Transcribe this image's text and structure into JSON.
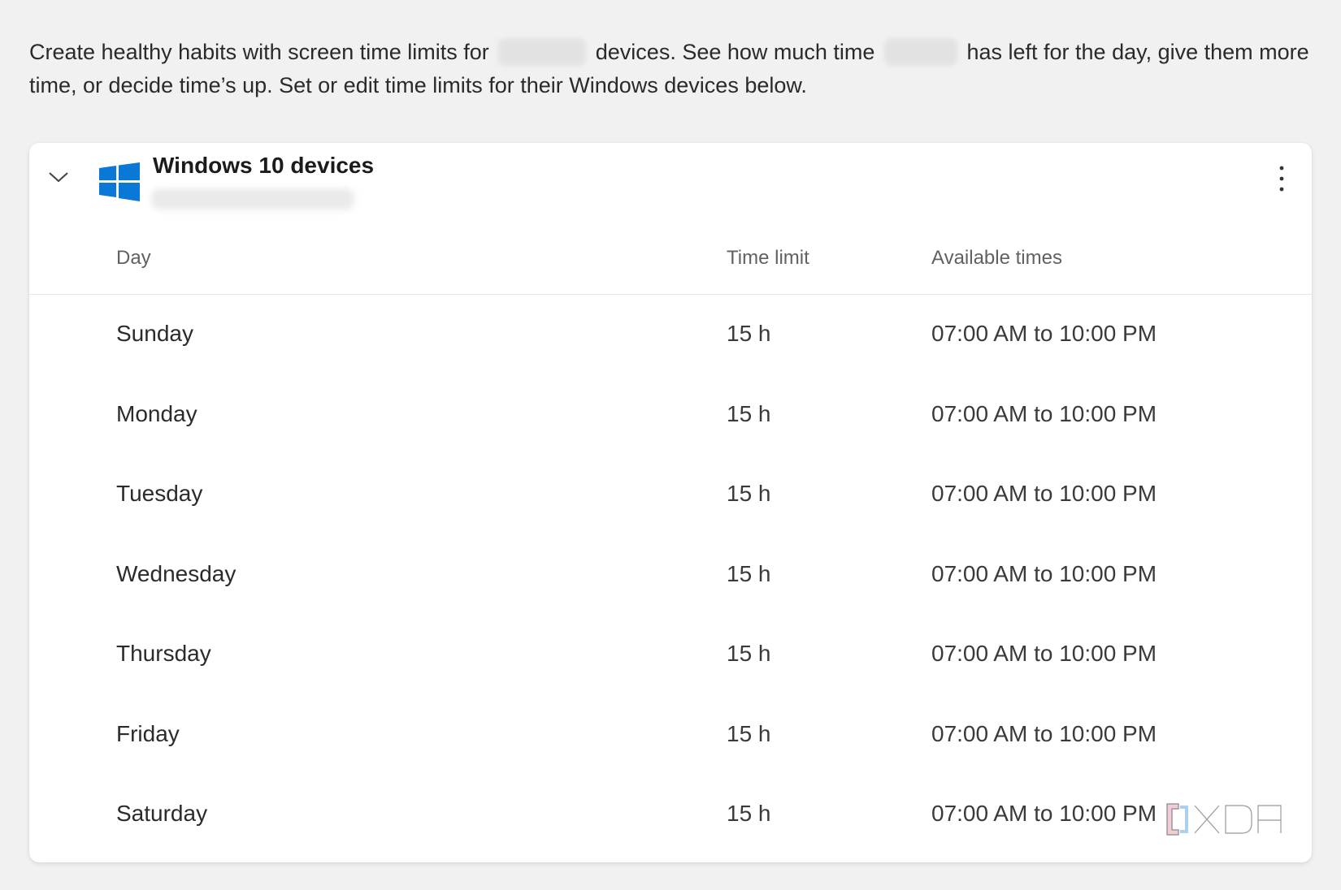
{
  "intro": {
    "part1": "Create healthy habits with screen time limits for",
    "part2": "devices. See how much time",
    "part3": "has left for the day, give them more time, or decide time’s up. Set or edit time limits for their Windows devices below."
  },
  "card": {
    "title": "Windows 10 devices",
    "logo_icon": "windows-logo-icon",
    "accent_color": "#0a78d7"
  },
  "table": {
    "headers": {
      "day": "Day",
      "time_limit": "Time limit",
      "available_times": "Available times"
    },
    "rows": [
      {
        "day": "Sunday",
        "limit": "15 h",
        "available": "07:00 AM to 10:00 PM"
      },
      {
        "day": "Monday",
        "limit": "15 h",
        "available": "07:00 AM to 10:00 PM"
      },
      {
        "day": "Tuesday",
        "limit": "15 h",
        "available": "07:00 AM to 10:00 PM"
      },
      {
        "day": "Wednesday",
        "limit": "15 h",
        "available": "07:00 AM to 10:00 PM"
      },
      {
        "day": "Thursday",
        "limit": "15 h",
        "available": "07:00 AM to 10:00 PM"
      },
      {
        "day": "Friday",
        "limit": "15 h",
        "available": "07:00 AM to 10:00 PM"
      },
      {
        "day": "Saturday",
        "limit": "15 h",
        "available": "07:00 AM to 10:00 PM"
      }
    ]
  },
  "watermark": {
    "text": "XDA"
  }
}
